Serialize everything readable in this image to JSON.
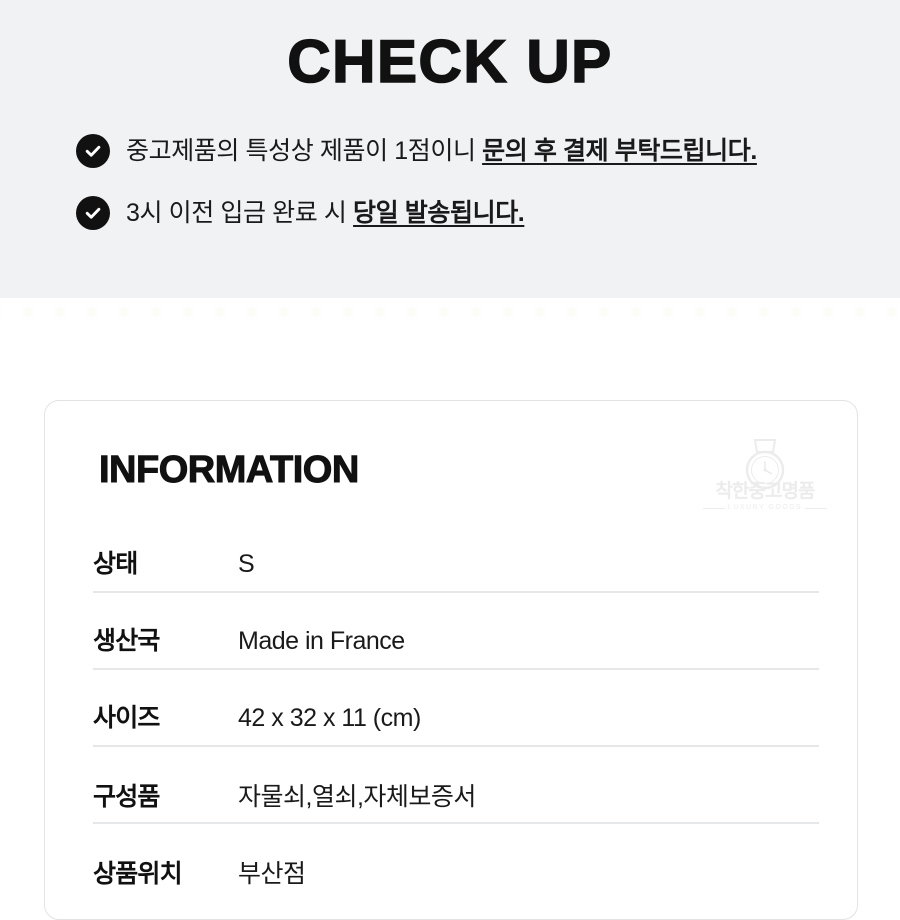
{
  "checkup": {
    "title": "CHECK UP",
    "items": [
      {
        "icon": "check-circle-icon",
        "text_plain": "중고제품의 특성상 제품이 1점이니 ",
        "text_emphasis": "문의 후 결제 부탁드립니다."
      },
      {
        "icon": "check-circle-icon",
        "text_plain": "3시 이전 입금 완료 시 ",
        "text_emphasis": "당일 발송됩니다."
      }
    ]
  },
  "information": {
    "heading": "INFORMATION",
    "watermark": {
      "icon": "watch-icon",
      "name": "착한중고명품",
      "subtitle": "LUXURY GOODS"
    },
    "rows": [
      {
        "label": "상태",
        "value": "S"
      },
      {
        "label": "생산국",
        "value": "Made in France"
      },
      {
        "label": "사이즈",
        "value": "42 x 32 x 11 (cm)"
      },
      {
        "label": "구성품",
        "value": "자물쇠,열쇠,자체보증서"
      },
      {
        "label": "상품위치",
        "value": "부산점"
      }
    ]
  },
  "colors": {
    "panel_background": "#f1f2f4",
    "page_background": "#ffffff",
    "text_primary": "#111111",
    "icon_fill": "#111111",
    "divider": "#e6e7e8",
    "card_border": "#e2e3e5",
    "watermark": "#ececec"
  }
}
